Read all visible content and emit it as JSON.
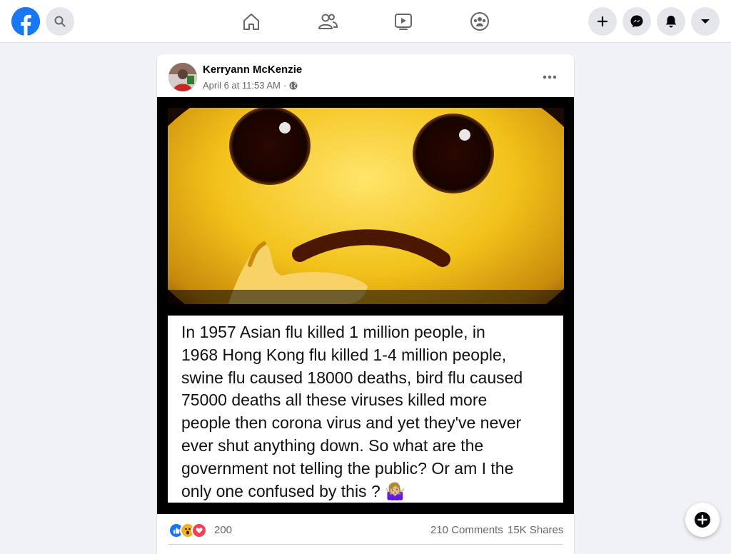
{
  "topbar": {
    "logo_icon": "facebook-logo-icon",
    "search_icon": "search-icon",
    "nav_icons": [
      "home-icon",
      "friends-icon",
      "watch-icon",
      "groups-icon"
    ],
    "right_buttons": [
      "create-plus-icon",
      "messenger-icon",
      "notifications-bell-icon",
      "account-caret-icon"
    ]
  },
  "post": {
    "author": "Kerryann McKenzie",
    "timestamp": "April 6 at 11:53 AM",
    "separator": "·",
    "privacy_icon": "globe-icon",
    "more_icon": "more-horizontal-icon",
    "image_text": "In 1957 Asian flu killed 1 million people, in\n1968 Hong Kong flu killed 1-4 million people,\nswine flu caused 18000 deaths,  bird flu caused\n75000 deaths all these viruses killed more\npeople then corona virus and yet they've never\never shut anything down. So what are the\ngovernment not telling the public? Or am I the\nonly one confused by this ? 🤷🏼‍♀️",
    "reaction_icons": [
      "like-icon",
      "wow-icon",
      "love-icon"
    ],
    "reaction_count": "200",
    "comments": "210 Comments",
    "shares": "15K Shares"
  },
  "fab_icon": "new-message-plus-icon",
  "colors": {
    "brand": "#1877f2",
    "background": "#f0f2f5",
    "secondary_text": "#65676b",
    "love": "#f33e58",
    "wow": "#f7b125"
  }
}
